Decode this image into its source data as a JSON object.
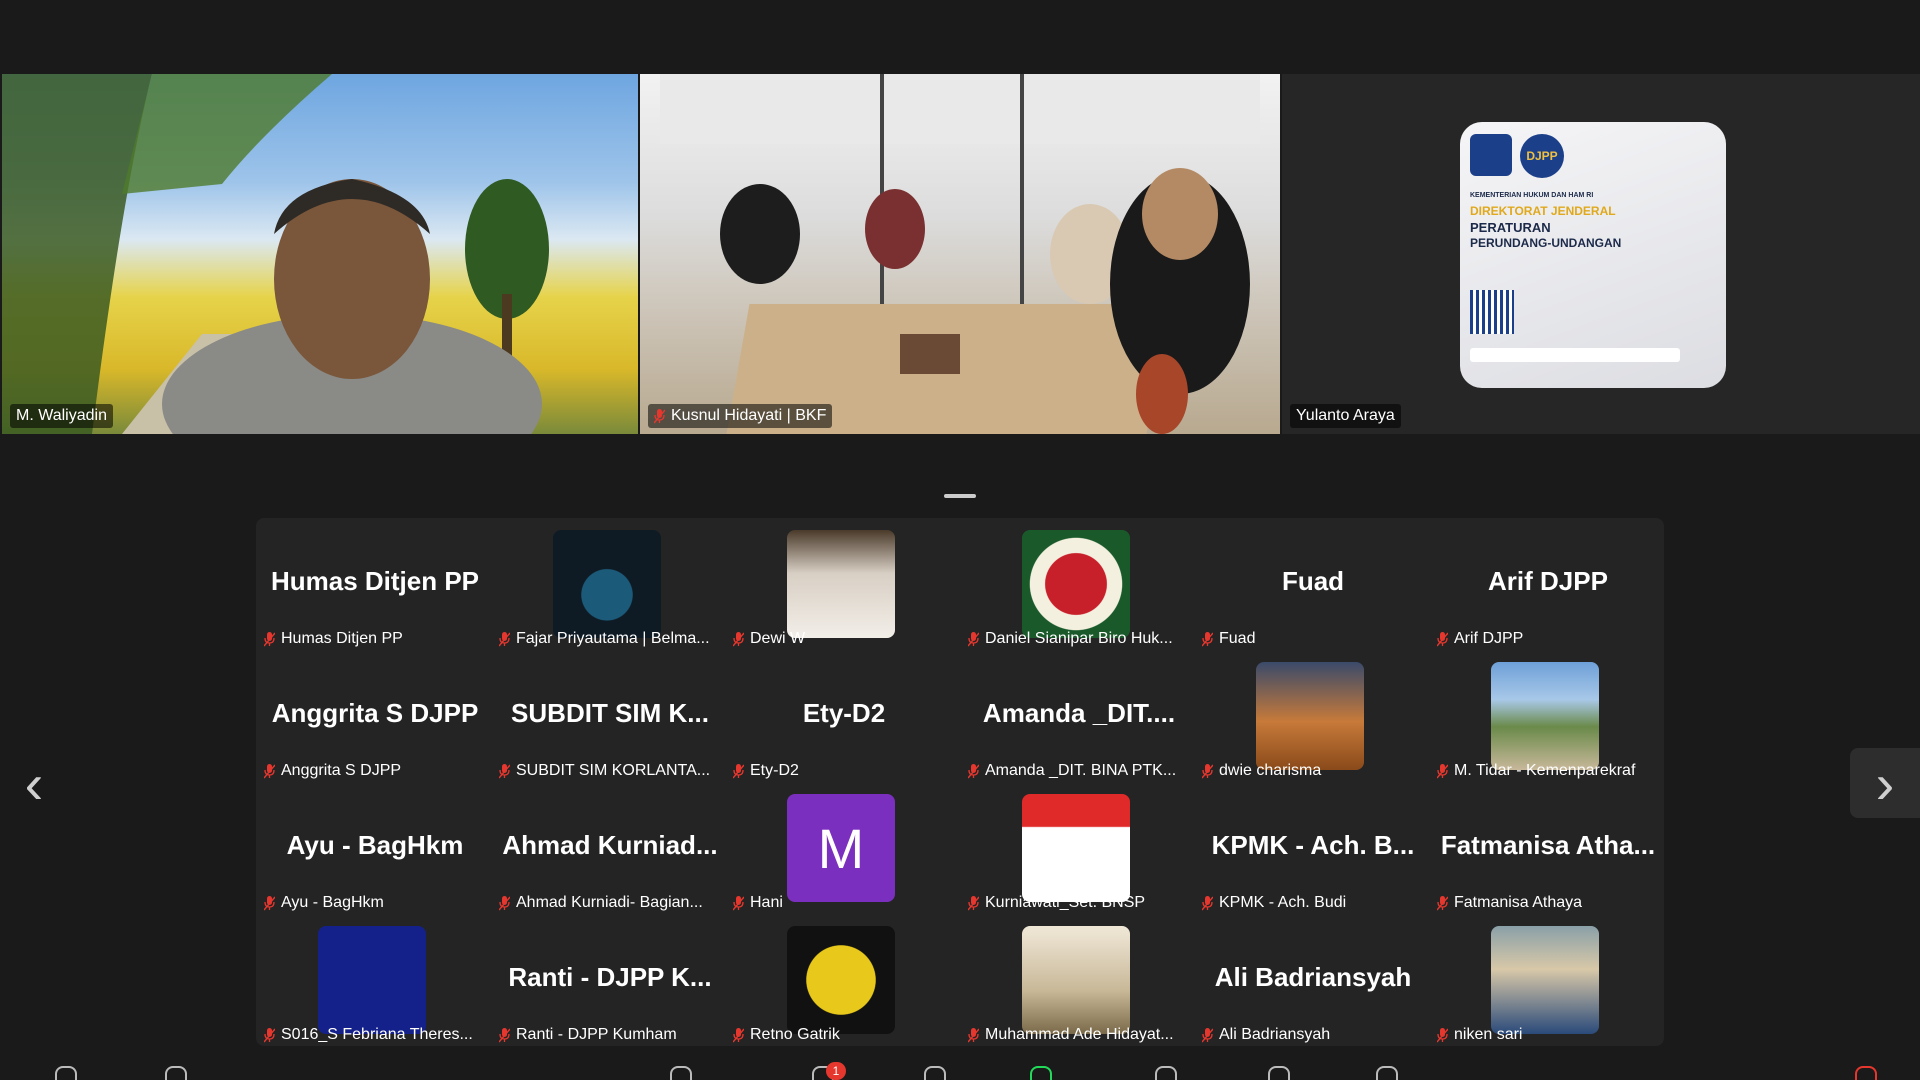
{
  "speakers": [
    {
      "name": "M. Waliyadin",
      "muted": false,
      "active": true
    },
    {
      "name": "Kusnul Hidayati | BKF",
      "muted": true,
      "active": false
    },
    {
      "name": "Yulanto Araya",
      "muted": false,
      "active": false
    }
  ],
  "poster": {
    "logo_text": "DJPP",
    "ministry": "KEMENTERIAN HUKUM DAN HAM RI",
    "title_line1": "DIREKTORAT JENDERAL",
    "title_line2": "PERATURAN",
    "title_line3": "PERUNDANG-UNDANGAN"
  },
  "gallery": [
    {
      "center": "Humas Ditjen PP",
      "label": "Humas Ditjen PP",
      "avatar": "none"
    },
    {
      "center": "",
      "label": "Fajar Priyautama | Belma...",
      "avatar": "image-dark"
    },
    {
      "center": "",
      "label": "Dewi W",
      "avatar": "image-photo"
    },
    {
      "center": "",
      "label": "Daniel Sianipar Biro Huk...",
      "avatar": "image-garuda"
    },
    {
      "center": "Fuad",
      "label": "Fuad",
      "avatar": "none"
    },
    {
      "center": "Arif DJPP",
      "label": "Arif DJPP",
      "avatar": "none"
    },
    {
      "center": "Anggrita S DJPP",
      "label": "Anggrita S DJPP",
      "avatar": "none"
    },
    {
      "center": "SUBDIT SIM K...",
      "label": "SUBDIT SIM KORLANTA...",
      "avatar": "none"
    },
    {
      "center": "Ety-D2",
      "label": "Ety-D2",
      "avatar": "none"
    },
    {
      "center": "Amanda _DIT....",
      "label": "Amanda _DIT. BINA PTK...",
      "avatar": "none"
    },
    {
      "center": "",
      "label": "dwie charisma",
      "avatar": "image-tree"
    },
    {
      "center": "",
      "label": "M. Tidar - Kemenparekraf",
      "avatar": "image-landscape"
    },
    {
      "center": "Ayu - BagHkm",
      "label": "Ayu - BagHkm",
      "avatar": "none"
    },
    {
      "center": "Ahmad Kurniad...",
      "label": "Ahmad Kurniadi- Bagian...",
      "avatar": "none"
    },
    {
      "center": "",
      "label": "Hani",
      "avatar": "letter",
      "letter": "M"
    },
    {
      "center": "",
      "label": "Kurniawati_Set. BNSP",
      "avatar": "image-portrait"
    },
    {
      "center": "KPMK - Ach. B...",
      "label": "KPMK - Ach. Budi",
      "avatar": "none"
    },
    {
      "center": "Fatmanisa Atha...",
      "label": "Fatmanisa Athaya",
      "avatar": "none"
    },
    {
      "center": "",
      "label": "S016_S Febriana Theres...",
      "avatar": "image-blue"
    },
    {
      "center": "Ranti - DJPP K...",
      "label": "Ranti - DJPP Kumham",
      "avatar": "none"
    },
    {
      "center": "",
      "label": "Retno Gatrik",
      "avatar": "image-emblem"
    },
    {
      "center": "",
      "label": "Muhammad Ade Hidayat...",
      "avatar": "image-sea"
    },
    {
      "center": "Ali Badriansyah",
      "label": "Ali Badriansyah",
      "avatar": "none"
    },
    {
      "center": "",
      "label": "niken sari",
      "avatar": "image-woman"
    }
  ],
  "avatar_letter": "M",
  "badge": "1",
  "nav": {
    "prev": "‹",
    "next": "›"
  },
  "colors": {
    "active_border": "#23d959",
    "muted_red": "#e5372e",
    "letter_bg": "#7b2fbe"
  }
}
